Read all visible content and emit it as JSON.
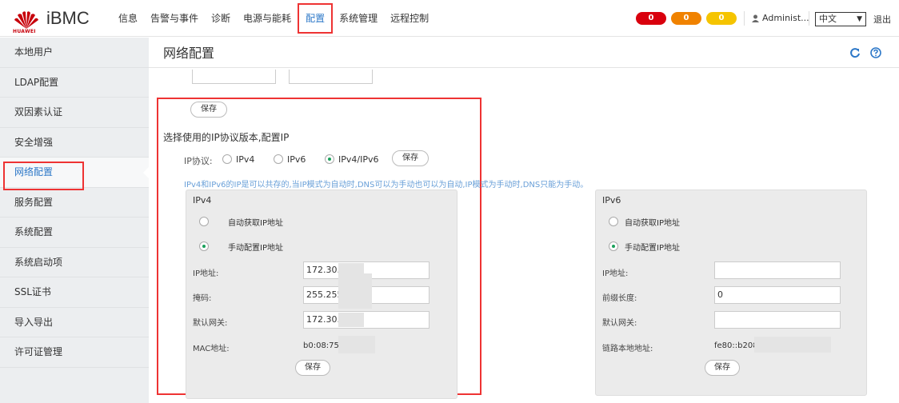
{
  "header": {
    "brand": "iBMC",
    "logo_text": "HUAWEI",
    "nav": [
      "信息",
      "告警与事件",
      "诊断",
      "电源与能耗",
      "配置",
      "系统管理",
      "远程控制"
    ],
    "badges": [
      "0",
      "0",
      "0"
    ],
    "user": "Administ...",
    "language": "中文",
    "logout": "退出"
  },
  "sidebar": {
    "items": [
      "本地用户",
      "LDAP配置",
      "双因素认证",
      "安全增强",
      "网络配置",
      "服务配置",
      "系统配置",
      "系统启动项",
      "SSL证书",
      "导入导出",
      "许可证管理"
    ]
  },
  "main": {
    "title": "网络配置",
    "save_top": "保存",
    "section_title": "选择使用的IP协议版本,配置IP",
    "protocol_label": "IP协议:",
    "protocols": [
      "IPv4",
      "IPv6",
      "IPv4/IPv6"
    ],
    "protocol_save": "保存",
    "note": "IPv4和IPv6的IP是可以共存的,当IP模式为自动时,DNS可以为手动也可以为自动,IP模式为手动时,DNS只能为手动。",
    "ipv4": {
      "title": "IPv4",
      "auto": "自动获取IP地址",
      "manual": "手动配置IP地址",
      "ip_label": "IP地址:",
      "ip_value": "172.30.3",
      "mask_label": "掩码:",
      "mask_value": "255.255",
      "gw_label": "默认网关:",
      "gw_value": "172.30.3",
      "mac_label": "MAC地址:",
      "mac_value": "b0:08:75",
      "save": "保存"
    },
    "ipv6": {
      "title": "IPv6",
      "auto": "自动获取IP地址",
      "manual": "手动配置IP地址",
      "ip_label": "IP地址:",
      "ip_value": "",
      "prefix_label": "前缀长度:",
      "prefix_value": "0",
      "gw_label": "默认网关:",
      "gw_value": "",
      "link_label": "链路本地地址:",
      "link_value": "fe80::b208",
      "save": "保存"
    }
  }
}
